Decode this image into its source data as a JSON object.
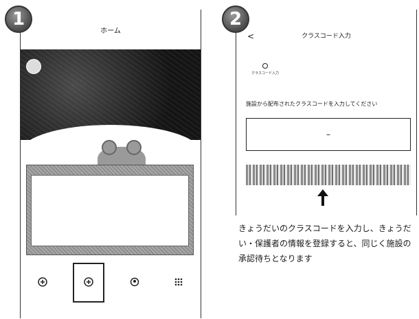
{
  "steps": {
    "first": "1",
    "second": "2"
  },
  "screen1": {
    "header_title": "ホーム",
    "user_name": "",
    "facility_subtitle": "",
    "facility_name": "",
    "notice_text": "",
    "nav": [
      {
        "label": "",
        "icon": "add-icon",
        "selected": false
      },
      {
        "label": "",
        "icon": "class-code-icon",
        "selected": true
      },
      {
        "label": "",
        "icon": "account-icon",
        "selected": false
      },
      {
        "label": "",
        "icon": "menu-icon",
        "selected": false
      }
    ]
  },
  "screen2": {
    "back_label": "<",
    "header_title": "クラスコード入力",
    "steps": [
      {
        "label": "クラスコード入力",
        "active": true
      },
      {
        "label": "",
        "active": false
      },
      {
        "label": "",
        "active": false
      },
      {
        "label": "",
        "active": false
      }
    ],
    "instruction": "施設から配布されたクラスコードを入力してください",
    "input_value": "–"
  },
  "caption": "きょうだいのクラスコードを入力し、きょうだい・保護者の情報を登録すると、同じく施設の承認待ちとなります"
}
